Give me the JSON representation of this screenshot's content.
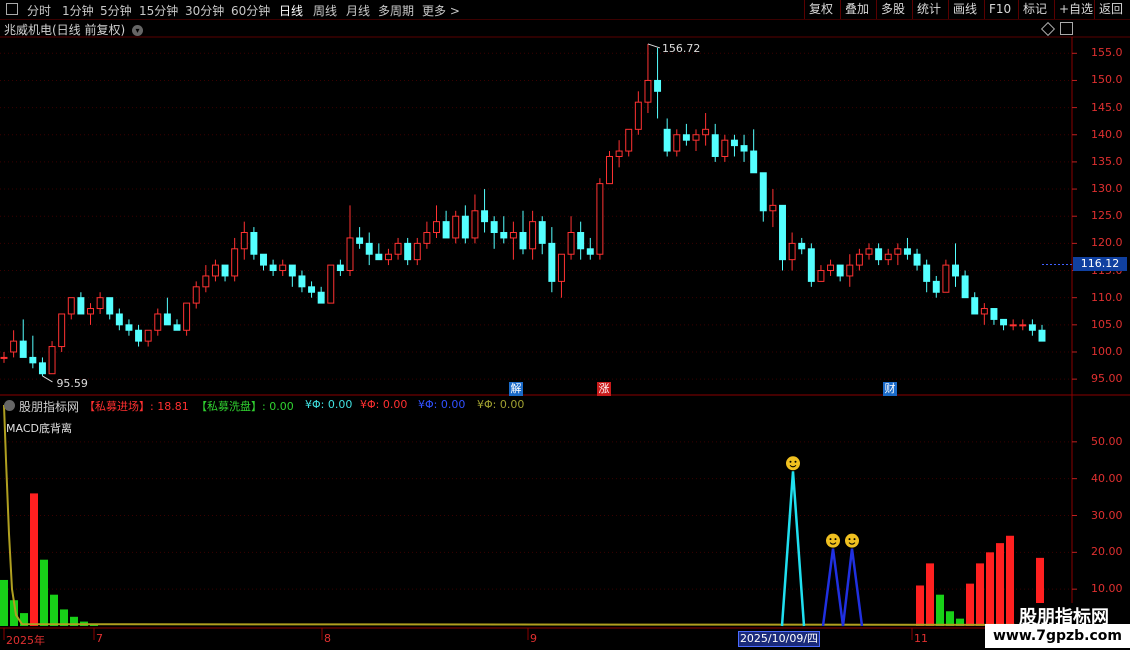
{
  "toolbar": {
    "periods": [
      "分时",
      "1分钟",
      "5分钟",
      "15分钟",
      "30分钟",
      "60分钟",
      "日线",
      "周线",
      "月线",
      "多周期",
      "更多 >"
    ],
    "active_period": "日线",
    "actions": [
      "复权",
      "叠加",
      "多股",
      "统计",
      "画线",
      "F10",
      "标记",
      "+自选",
      "返回"
    ]
  },
  "chart": {
    "title": "兆威机电(日线 前复权)",
    "high_label": "156.72",
    "low_label": "95.59",
    "current_price": "116.12",
    "y_ticks": [
      "155.0",
      "150.0",
      "145.0",
      "140.0",
      "135.0",
      "130.0",
      "125.0",
      "120.0",
      "115.0",
      "110.0",
      "105.0",
      "100.0",
      "95.00"
    ],
    "events": [
      {
        "label": "解",
        "color": "#1a6ac8"
      },
      {
        "label": "涨",
        "color": "#c81a1a"
      },
      {
        "label": "财",
        "color": "#1a6ac8"
      }
    ]
  },
  "indicator": {
    "name": "股朋指标网",
    "items": [
      {
        "text": "【私募进场】: 18.81",
        "color": "#ff3030"
      },
      {
        "text": "【私募洗盘】: 0.00",
        "color": "#30d030"
      },
      {
        "text": "¥Φ: 0.00",
        "color": "#40e0e0"
      },
      {
        "text": "¥Φ: 0.00",
        "color": "#ff3030"
      },
      {
        "text": "¥Φ: 0.00",
        "color": "#3050ff"
      },
      {
        "text": "¥Φ: 0.00",
        "color": "#a0a030"
      }
    ],
    "line_label": "MACD底背离",
    "y_ticks": [
      "50.00",
      "40.00",
      "30.00",
      "20.00",
      "10.00"
    ]
  },
  "xaxis": {
    "labels": [
      "2025年",
      "7",
      "8",
      "9",
      "11"
    ],
    "cursor_date": "2025/10/09/四"
  },
  "watermark": {
    "name": "股朋指标网",
    "url": "www.7gpzb.com"
  },
  "chart_data": {
    "type": "candlestick",
    "ylim": [
      93,
      158
    ],
    "candles": [
      [
        99,
        100,
        98,
        99
      ],
      [
        100,
        104,
        99,
        102
      ],
      [
        102,
        106,
        100,
        99
      ],
      [
        99,
        103,
        97,
        98
      ],
      [
        98,
        99,
        95.59,
        96
      ],
      [
        96,
        102,
        96,
        101
      ],
      [
        101,
        106,
        100,
        107
      ],
      [
        107,
        110,
        106,
        110
      ],
      [
        110,
        111,
        107,
        107
      ],
      [
        107,
        109,
        105,
        108
      ],
      [
        108,
        111,
        107,
        110
      ],
      [
        110,
        110,
        106,
        107
      ],
      [
        107,
        108,
        104,
        105
      ],
      [
        105,
        106,
        103,
        104
      ],
      [
        104,
        105,
        101,
        102
      ],
      [
        102,
        104,
        101,
        104
      ],
      [
        104,
        108,
        103,
        107
      ],
      [
        107,
        110,
        106,
        105
      ],
      [
        105,
        106,
        104,
        104
      ],
      [
        104,
        109,
        103,
        109
      ],
      [
        109,
        113,
        108,
        112
      ],
      [
        112,
        116,
        111,
        114
      ],
      [
        114,
        117,
        113,
        116
      ],
      [
        116,
        116,
        113,
        114
      ],
      [
        114,
        121,
        113,
        119
      ],
      [
        119,
        124,
        117,
        122
      ],
      [
        122,
        123,
        117,
        118
      ],
      [
        118,
        118,
        115,
        116
      ],
      [
        116,
        117,
        114,
        115
      ],
      [
        115,
        117,
        114,
        116
      ],
      [
        116,
        116,
        112,
        114
      ],
      [
        114,
        115,
        111,
        112
      ],
      [
        112,
        113,
        110,
        111
      ],
      [
        111,
        112,
        109,
        109
      ],
      [
        109,
        116,
        109,
        116
      ],
      [
        116,
        117,
        114,
        115
      ],
      [
        115,
        127,
        114,
        121
      ],
      [
        121,
        123,
        119,
        120
      ],
      [
        120,
        122,
        116,
        118
      ],
      [
        118,
        120,
        117,
        117
      ],
      [
        117,
        119,
        116,
        118
      ],
      [
        118,
        121,
        117,
        120
      ],
      [
        120,
        121,
        116,
        117
      ],
      [
        117,
        121,
        116,
        120
      ],
      [
        120,
        124,
        119,
        122
      ],
      [
        122,
        127,
        121,
        124
      ],
      [
        124,
        126,
        121,
        121
      ],
      [
        121,
        126,
        120,
        125
      ],
      [
        125,
        127,
        120,
        121
      ],
      [
        121,
        129,
        120,
        126
      ],
      [
        126,
        130,
        122,
        124
      ],
      [
        124,
        125,
        119,
        122
      ],
      [
        122,
        125,
        120,
        121
      ],
      [
        121,
        124,
        117,
        122
      ],
      [
        122,
        126,
        118,
        119
      ],
      [
        119,
        126,
        117,
        124
      ],
      [
        124,
        125,
        118,
        120
      ],
      [
        120,
        123,
        111,
        113
      ],
      [
        113,
        118,
        110,
        118
      ],
      [
        118,
        125,
        117,
        122
      ],
      [
        122,
        124,
        117,
        119
      ],
      [
        119,
        121,
        117,
        118
      ],
      [
        118,
        132,
        117,
        131
      ],
      [
        131,
        137,
        131,
        136
      ],
      [
        136,
        139,
        134,
        137
      ],
      [
        137,
        141,
        136,
        141
      ],
      [
        141,
        148,
        140,
        146
      ],
      [
        146,
        156.72,
        144,
        150
      ],
      [
        150,
        156,
        143,
        148
      ],
      [
        141,
        143,
        136,
        137
      ],
      [
        137,
        141,
        136,
        140
      ],
      [
        140,
        142,
        138,
        139
      ],
      [
        139,
        141,
        137,
        140
      ],
      [
        140,
        144,
        138,
        141
      ],
      [
        140,
        142,
        135,
        136
      ],
      [
        136,
        140,
        135,
        139
      ],
      [
        139,
        140,
        136,
        138
      ],
      [
        138,
        140,
        135,
        137
      ],
      [
        137,
        141,
        133,
        133
      ],
      [
        133,
        131,
        124,
        126
      ],
      [
        126,
        130,
        123,
        127
      ],
      [
        127,
        125,
        115,
        117
      ],
      [
        117,
        122,
        115,
        120
      ],
      [
        120,
        121,
        118,
        119
      ],
      [
        119,
        120,
        112,
        113
      ],
      [
        113,
        116,
        113,
        115
      ],
      [
        115,
        117,
        114,
        116
      ],
      [
        116,
        116,
        113,
        114
      ],
      [
        114,
        118,
        112,
        116
      ],
      [
        116,
        119,
        115,
        118
      ],
      [
        118,
        120,
        117,
        119
      ],
      [
        119,
        120,
        116,
        117
      ],
      [
        117,
        119,
        116,
        118
      ],
      [
        118,
        120,
        116,
        119
      ],
      [
        119,
        121,
        117,
        118
      ],
      [
        118,
        119,
        115,
        116
      ],
      [
        116,
        117,
        111,
        113
      ],
      [
        113,
        114,
        110,
        111
      ],
      [
        111,
        117,
        111,
        116
      ],
      [
        116,
        120,
        112,
        114
      ],
      [
        114,
        115,
        110,
        110
      ],
      [
        110,
        111,
        107,
        107
      ],
      [
        107,
        109,
        105,
        108
      ],
      [
        108,
        108,
        105,
        106
      ],
      [
        106,
        106,
        104,
        105
      ],
      [
        105,
        106,
        104,
        105
      ],
      [
        105,
        106,
        104,
        105
      ],
      [
        105,
        106,
        103,
        104
      ],
      [
        104,
        105,
        102,
        102
      ]
    ]
  }
}
